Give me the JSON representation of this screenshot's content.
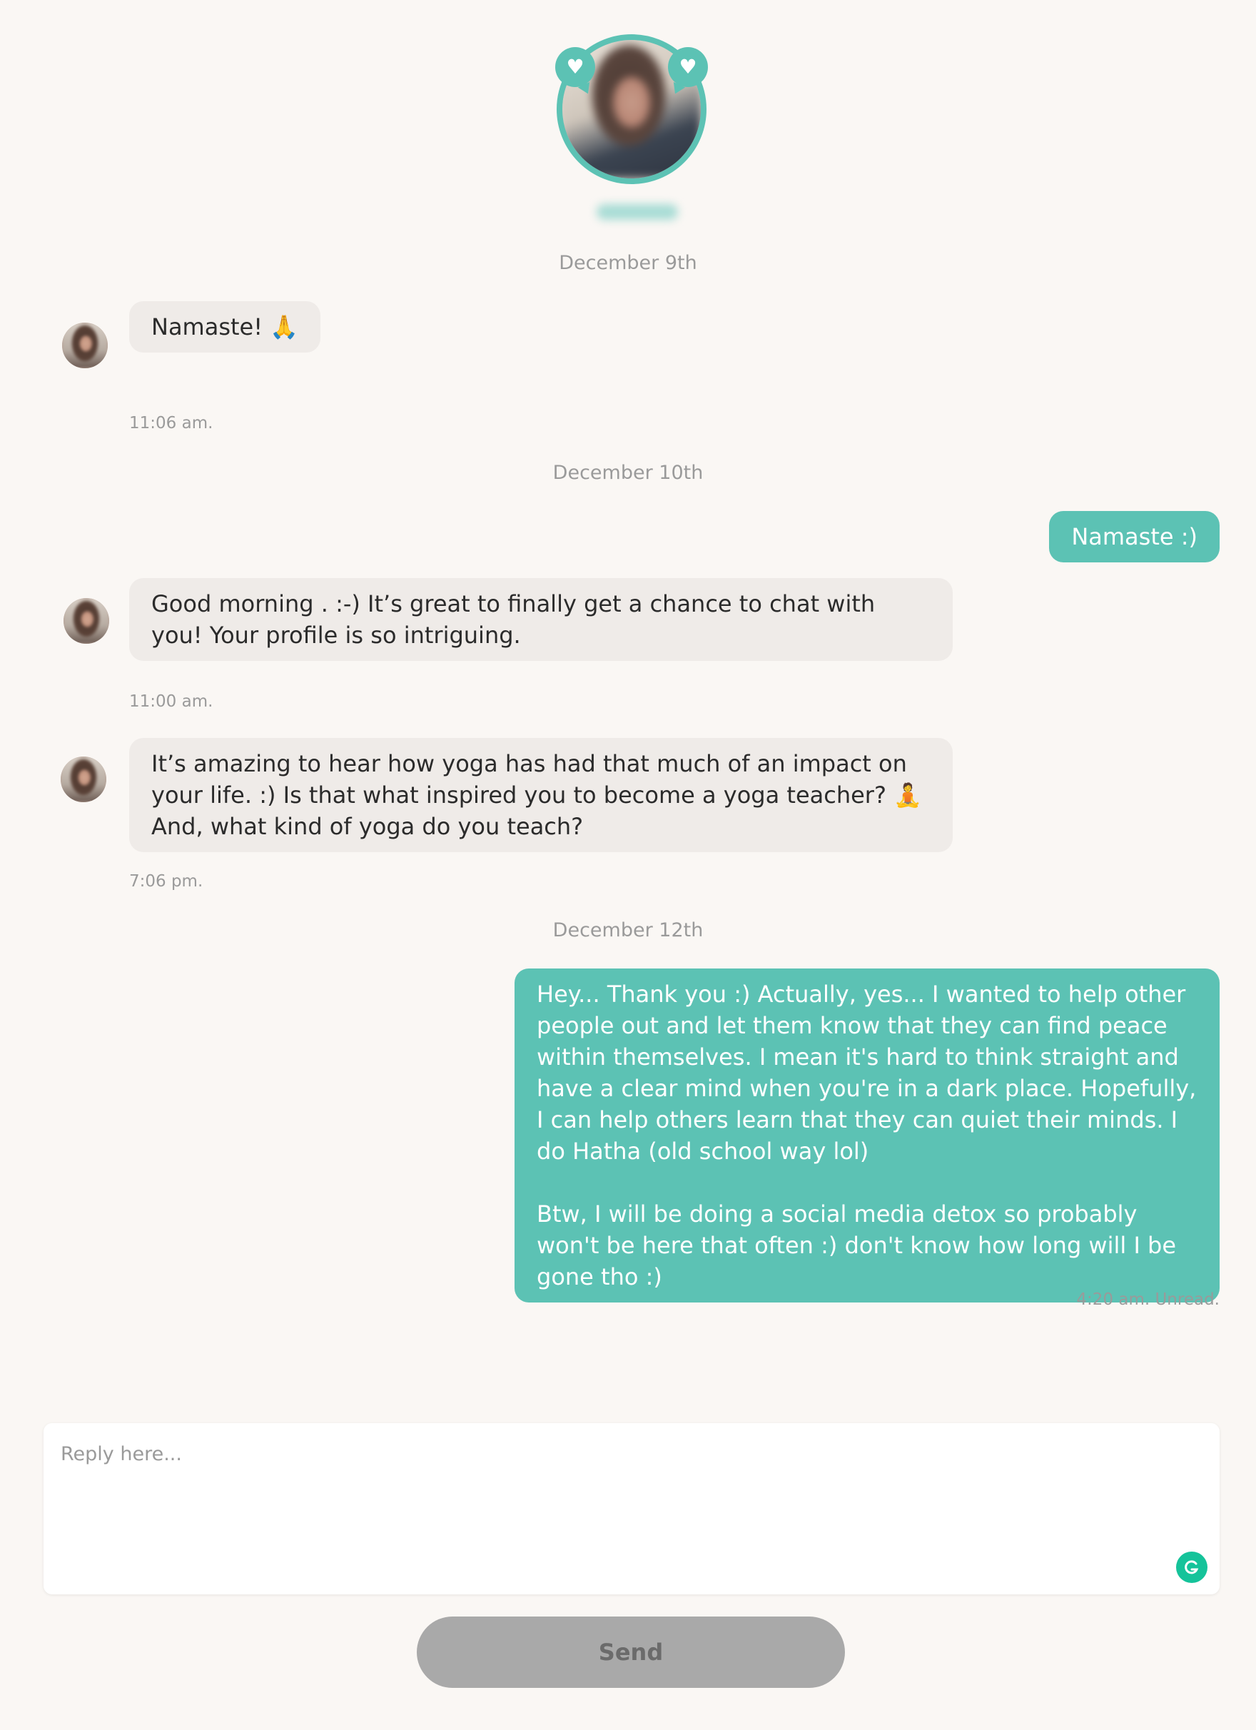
{
  "profile": {
    "photo_icon": "blurred-profile-photo",
    "heart_icons": [
      "heart-icon",
      "heart-icon"
    ]
  },
  "conversation": [
    {
      "type": "date",
      "text": "December 9th"
    },
    {
      "type": "incoming",
      "text": "Namaste! 🙏",
      "time": "11:06 am."
    },
    {
      "type": "date",
      "text": "December 10th"
    },
    {
      "type": "outgoing",
      "text": "Namaste :)"
    },
    {
      "type": "incoming",
      "text": "Good morning . :-) It’s great to finally get a chance to chat with you! Your profile is so intriguing.",
      "time": "11:00 am."
    },
    {
      "type": "incoming",
      "text": "It’s amazing to hear how yoga has had that much of an impact on your life. :) Is that what inspired you to become a yoga teacher? 🧘  And, what kind of yoga do you teach?",
      "time": "7:06 pm."
    },
    {
      "type": "date",
      "text": "December 12th"
    },
    {
      "type": "outgoing",
      "text": "Hey... Thank you :) Actually, yes... I wanted to help other people out and let them know that they can find peace within themselves. I mean it's hard to think straight and have a clear mind when you're in a dark place. Hopefully, I can help others learn that they can quiet their minds. I do Hatha (old school way lol)\n\nBtw, I will be doing a social media detox so probably won't be here that often :) don't know how long will I be gone tho :)",
      "time": "4:20 am. Unread."
    }
  ],
  "composer": {
    "placeholder": "Reply here...",
    "send_label": "Send",
    "grammarly_icon": "grammarly-icon"
  },
  "colors": {
    "accent": "#5cc2b4",
    "incoming_bubble": "#efebe8",
    "background": "#faf7f4",
    "send_button": "#a9a9a9"
  }
}
